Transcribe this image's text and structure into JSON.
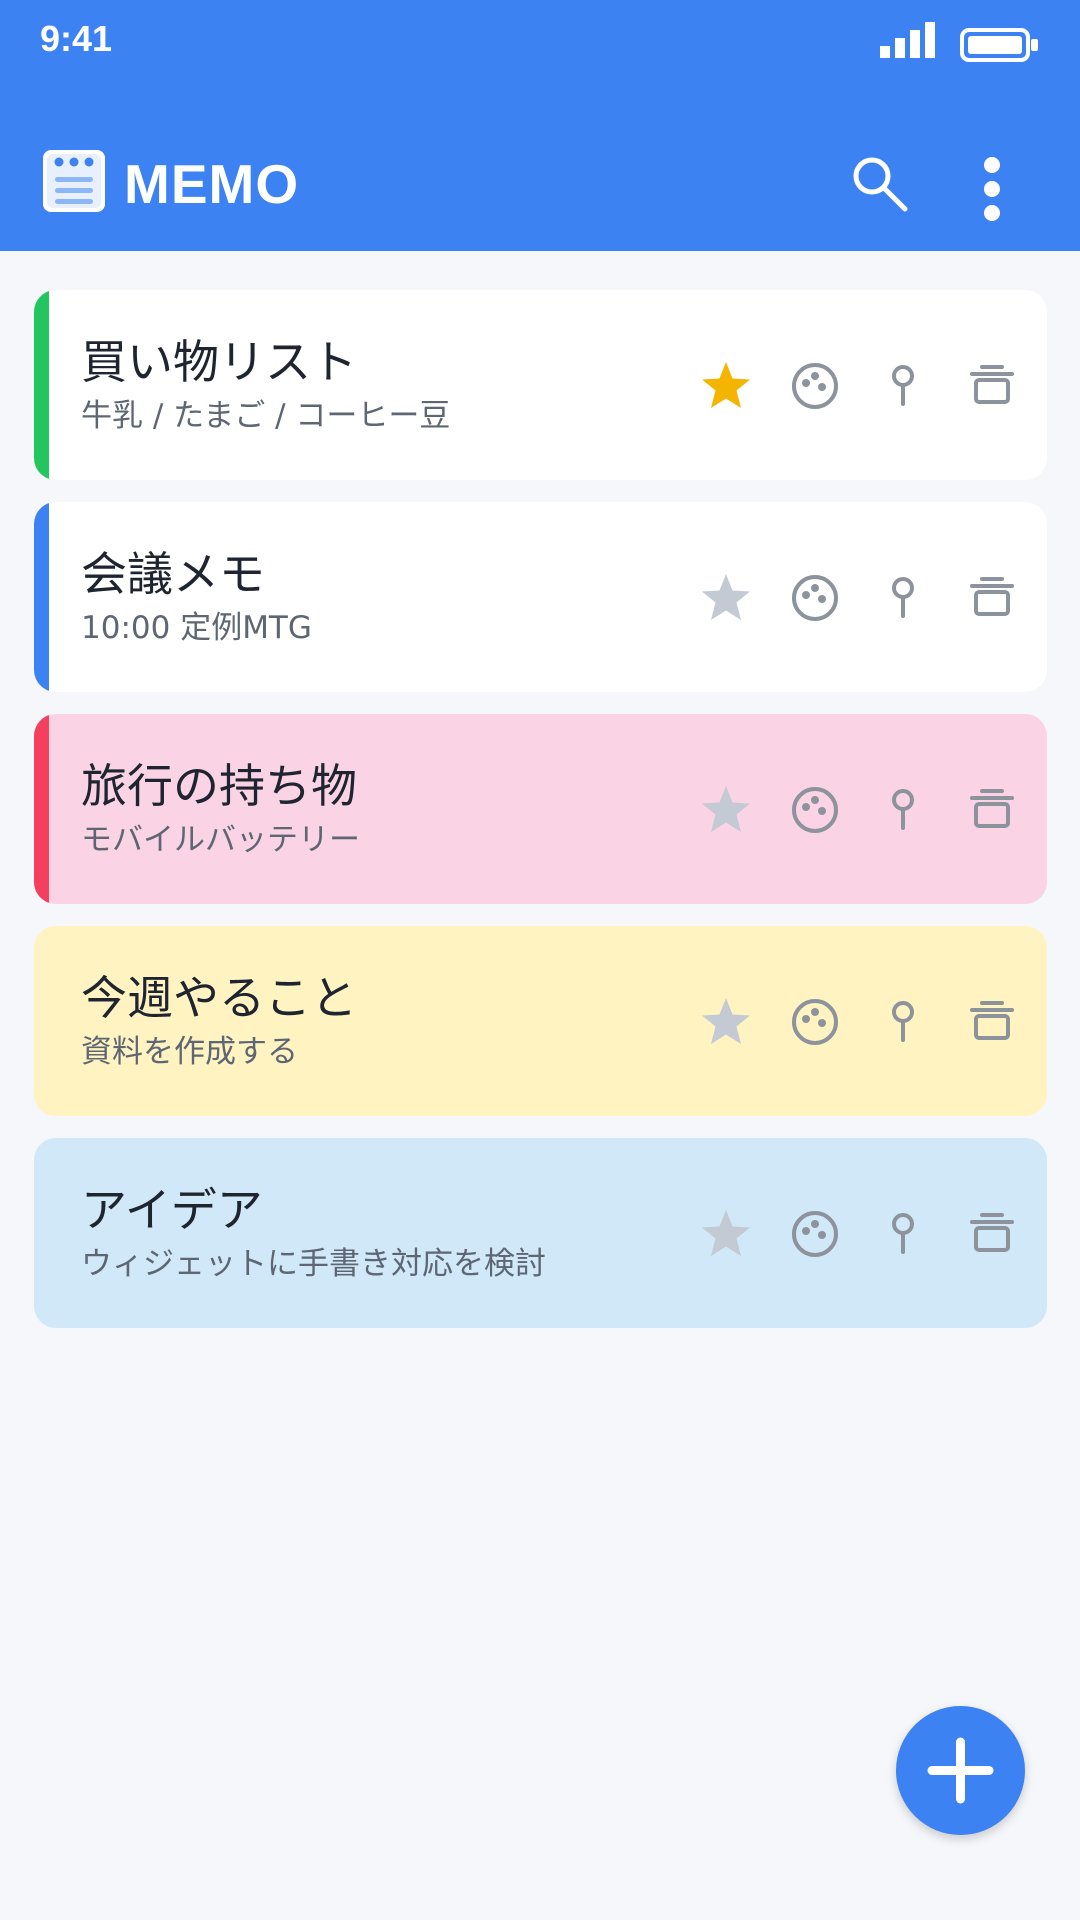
{
  "status_bar": {
    "time": "9:41"
  },
  "app_bar": {
    "title": "MEMO",
    "app_icon": "notepad-icon",
    "actions": [
      {
        "name": "search",
        "icon": "search-icon"
      },
      {
        "name": "more",
        "icon": "more-vertical-icon"
      }
    ]
  },
  "colors": {
    "primary": "#3D82F2",
    "star_active": "#F4B400",
    "star_inactive": "#C4CAD4",
    "action_icon": "#8D939D"
  },
  "memos": [
    {
      "title": "買い物リスト",
      "subtitle": "牛乳 / たまご / コーヒー豆",
      "starred": true,
      "background": "#FFFFFF",
      "accent": "#22C55E"
    },
    {
      "title": "会議メモ",
      "subtitle": "10:00 定例MTG",
      "starred": false,
      "background": "#FFFFFF",
      "accent": "#3D82F2"
    },
    {
      "title": "旅行の持ち物",
      "subtitle": "モバイルバッテリー",
      "starred": false,
      "background": "#FAD3E4",
      "accent": "#F43F5E"
    },
    {
      "title": "今週やること",
      "subtitle": "資料を作成する",
      "starred": false,
      "background": "#FFF3C2",
      "accent": ""
    },
    {
      "title": "アイデア",
      "subtitle": "ウィジェットに手書き対応を検討",
      "starred": false,
      "background": "#D0E8F8",
      "accent": ""
    }
  ],
  "card_actions": [
    "star-icon",
    "palette-icon",
    "pin-icon",
    "delete-icon"
  ],
  "fab": {
    "icon": "plus-icon"
  }
}
